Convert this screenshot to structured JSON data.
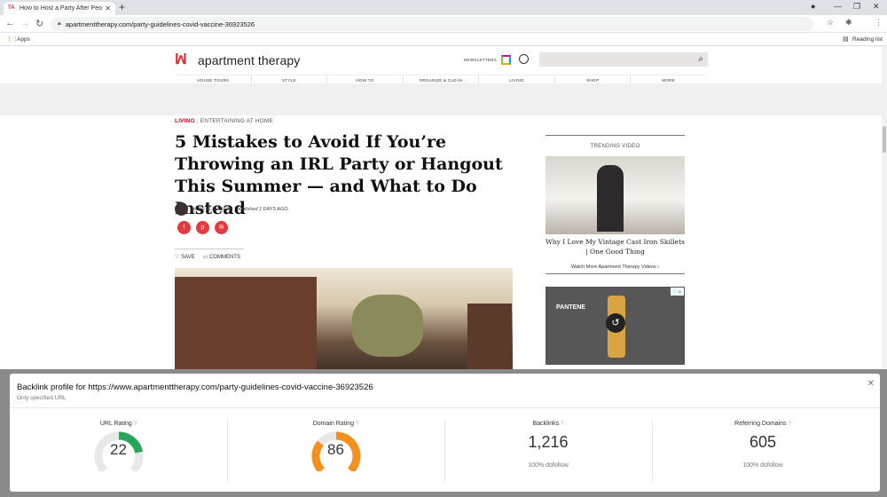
{
  "browser": {
    "tab_title": "How to Host a Party After People",
    "tab_favicon_text": "TA",
    "url": "apartmenttherapy.com/party-guidelines-covid-vaccine-36923526",
    "bookmarks_apps": "Apps",
    "reading_list": "Reading list"
  },
  "site": {
    "logo": "apartment therapy",
    "newsletters": "NEWSLETTERS",
    "nav": [
      "HOUSE TOURS",
      "STYLE",
      "HOW TO",
      "ORGANIZE & CLEAN",
      "LIVING",
      "SHOP",
      "MORE"
    ]
  },
  "article": {
    "category": "LIVING",
    "subcategory": "ENTERTAINING AT HOME",
    "headline": "5 Mistakes to Avoid If You’re Throwing an IRL Party or Hangout This Summer — and What to Do Instead",
    "byline_prefix": "by",
    "author": "DE ELIZABETH",
    "published_label": "published",
    "published_time": "2 DAYS AGO",
    "save_label": "SAVE",
    "comments_label": "COMMENTS"
  },
  "sidebar": {
    "trending_label": "TRENDING VIDEO",
    "video_title": "Why I Love My Vintage Cast Iron Skillets | One Good Thing",
    "watch_more": "Watch More Apartment Therapy Videos",
    "ad_brand": "PANTENE"
  },
  "backlink": {
    "title": "Backlink profile for https://www.apartmenttherapy.com/party-guidelines-covid-vaccine-36923526",
    "subtitle": "Only specified URL",
    "metrics": [
      {
        "name": "URL Rating",
        "value": "22",
        "gauge_fraction": 0.22,
        "color": "#27a65b"
      },
      {
        "name": "Domain Rating",
        "value": "86",
        "gauge_fraction": 0.86,
        "color": "#f5901e"
      },
      {
        "name": "Backlinks",
        "value": "1,216",
        "sub": "100% dofollow"
      },
      {
        "name": "Referring Domains",
        "value": "605",
        "sub": "100% dofollow"
      }
    ]
  },
  "colors": {
    "accent_red": "#d0021b",
    "gauge_track": "#e8e8e8"
  }
}
